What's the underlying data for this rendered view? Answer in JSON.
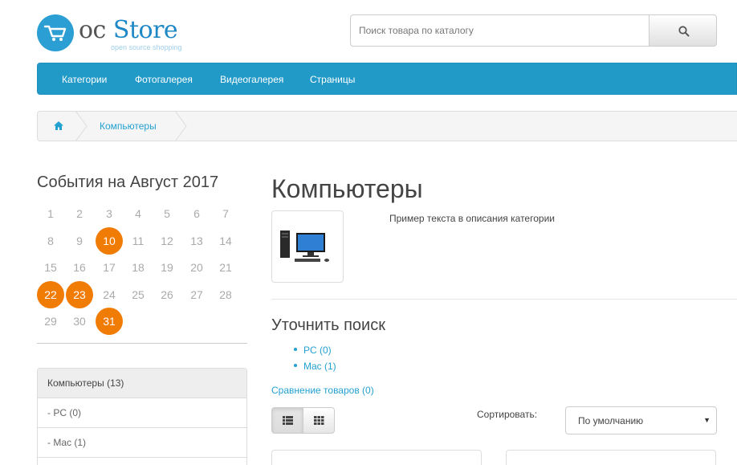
{
  "header": {
    "logo_brand_oc": "oc",
    "logo_brand_store": "Store",
    "logo_tagline": "open source shopping",
    "search_placeholder": "Поиск товара по каталогу"
  },
  "menu": {
    "items": [
      "Категории",
      "Фотогалерея",
      "Видеогалерея",
      "Страницы"
    ]
  },
  "breadcrumb": {
    "home_icon": "home-icon",
    "items": [
      "Компьютеры"
    ]
  },
  "calendar": {
    "title": "События на Август 2017",
    "days": [
      1,
      2,
      3,
      4,
      5,
      6,
      7,
      8,
      9,
      10,
      11,
      12,
      13,
      14,
      15,
      16,
      17,
      18,
      19,
      20,
      21,
      22,
      23,
      24,
      25,
      26,
      27,
      28,
      29,
      30,
      31
    ],
    "event_days": [
      10,
      22,
      23,
      31
    ],
    "event_color": "#f07b05"
  },
  "categories": {
    "items": [
      "Компьютеры (13)",
      " - PC (0)",
      " - Mac (1)"
    ]
  },
  "content": {
    "title": "Компьютеры",
    "description": "Пример текста в описания категории",
    "refine_title": "Уточнить поиск",
    "refine_items": [
      "PC (0)",
      "Mac (1)"
    ],
    "compare_link": "Сравнение товаров (0)",
    "sort_label": "Сортировать:",
    "sort_value": "По умолчанию"
  },
  "colors": {
    "accent": "#229ac8",
    "link": "#23a1d1"
  }
}
